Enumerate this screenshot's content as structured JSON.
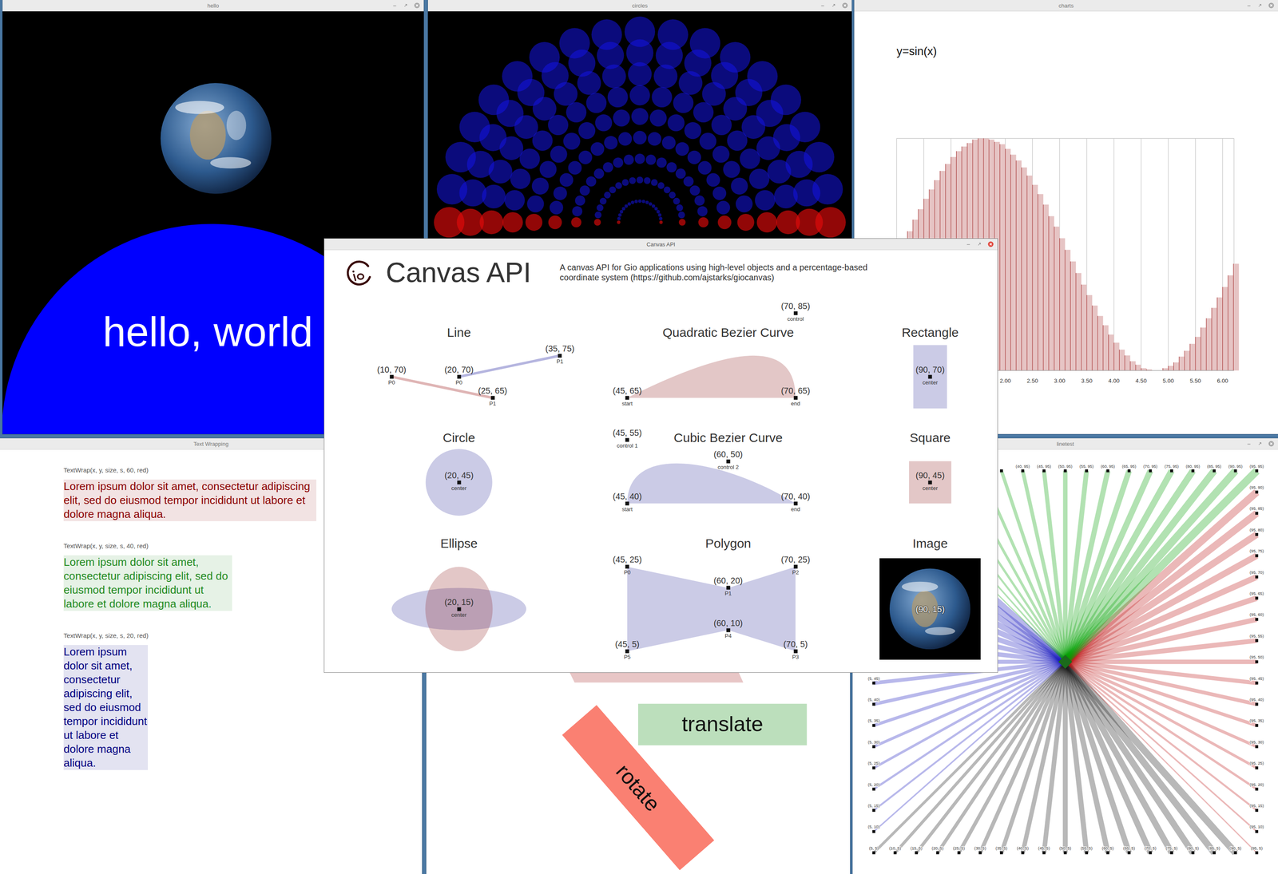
{
  "windows": [
    {
      "kind": "hello",
      "title": "hello",
      "focused": false,
      "text": "hello, world"
    },
    {
      "kind": "circles",
      "title": "circles",
      "focused": false
    },
    {
      "kind": "charts",
      "title": "charts",
      "focused": false,
      "chart": {
        "title": "y=sin(x)",
        "x_ticks": [
          "2.00",
          "2.50",
          "3.00",
          "3.50",
          "4.00",
          "4.50",
          "5.00",
          "5.50",
          "6.00"
        ],
        "series": [
          {
            "values": [
              0.0,
              0.1,
              0.2,
              0.3,
              0.39,
              0.48,
              0.56,
              0.64,
              0.72,
              0.78,
              0.84,
              0.89,
              0.93,
              0.96,
              0.99,
              1.0,
              1.0,
              0.99,
              0.97,
              0.95,
              0.91,
              0.86,
              0.81,
              0.75,
              0.68,
              0.6,
              0.52,
              0.43,
              0.33,
              0.24,
              0.14,
              0.04,
              -0.06,
              -0.16,
              -0.26,
              -0.35,
              -0.44,
              -0.53,
              -0.61,
              -0.69,
              -0.76,
              -0.82,
              -0.87,
              -0.92,
              -0.95,
              -0.98,
              -0.99,
              -1.0,
              -1.0,
              -0.98,
              -0.96,
              -0.93,
              -0.88,
              -0.83,
              -0.77,
              -0.71,
              -0.63,
              -0.55,
              -0.46,
              -0.37,
              -0.28,
              -0.18,
              -0.08
            ]
          }
        ]
      }
    },
    {
      "kind": "text_wrapping",
      "title": "Text Wrapping",
      "focused": false,
      "blocks": [
        {
          "caption": "TextWrap(x, y, size, s, 60, red)",
          "text": "Lorem ipsum dolor sit amet, consectetur adipiscing elit, sed do eiusmod tempor incididunt ut labore et dolore magna aliqua.",
          "color": "#8b0000"
        },
        {
          "caption": "TextWrap(x, y, size, s, 40, red)",
          "text": "Lorem ipsum dolor sit amet, consectetur adipiscing elit, sed do eiusmod tempor incididunt ut labore et dolore magna aliqua.",
          "color": "#1f8a1f"
        },
        {
          "caption": "TextWrap(x, y, size, s, 20, red)",
          "text": "Lorem ipsum dolor sit amet, consectetur adipiscing elit, sed do eiusmod tempor incididunt ut labore et dolore magna aliqua.",
          "color": "#000080"
        }
      ]
    },
    {
      "kind": "transforms",
      "focused": false,
      "shapes": [
        {
          "kind": "translate",
          "text": "translate"
        },
        {
          "kind": "rotate",
          "text": "rotate"
        }
      ]
    },
    {
      "kind": "linetest",
      "title": "linetest",
      "focused": false,
      "labels": [
        "(5, 5)",
        "(10, 5)",
        "(15, 5)",
        "(20, 5)",
        "(25, 5)",
        "(30, 5)",
        "(35, 5)",
        "(40, 5)",
        "(45, 5)",
        "(50, 5)",
        "(55, 5)",
        "(60, 5)",
        "(65, 5)",
        "(70, 5)",
        "(75, 5)",
        "(80, 5)",
        "(85, 5)",
        "(90, 5)",
        "(95, 5)",
        "(5, 10)",
        "(5, 15)",
        "(5, 20)",
        "(5, 25)",
        "(5, 30)",
        "(5, 35)",
        "(5, 40)",
        "(5, 45)",
        "(95, 10)",
        "(95, 15)",
        "(95, 20)",
        "(95, 25)",
        "(95, 30)",
        "(95, 35)",
        "(95, 40)",
        "(95, 45)",
        "(95, 50)",
        "(95, 55)",
        "(95, 60)",
        "(95, 65)",
        "(95, 70)",
        "(95, 75)",
        "(95, 80)",
        "(95, 85)",
        "(95, 90)",
        "(40, 95)",
        "(45, 95)",
        "(50, 95)",
        "(55, 95)",
        "(60, 95)",
        "(65, 95)",
        "(70, 95)",
        "(75, 95)",
        "(80, 95)",
        "(85, 95)",
        "(90, 95)",
        "(95, 95)"
      ]
    },
    {
      "kind": "canvas_api",
      "title": "Canvas API",
      "focused": true,
      "heading": "Canvas API",
      "description": "A canvas API for Gio applications using high-level objects and a percentage-based coordinate system (https://github.com/ajstarks/giocanvas)",
      "sections": [
        {
          "title": "Line",
          "kind": "line",
          "points": [
            {
              "label": "(10, 70)",
              "sub": "P0"
            },
            {
              "label": "(25, 65)",
              "sub": "P1"
            },
            {
              "label": "(20, 70)",
              "sub": "P0"
            },
            {
              "label": "(35, 75)",
              "sub": "P1"
            }
          ]
        },
        {
          "title": "Quadratic Bezier Curve",
          "kind": "quadratic",
          "points": [
            {
              "label": "(45, 65)",
              "sub": "start"
            },
            {
              "label": "(70, 85)",
              "sub": "control"
            },
            {
              "label": "(70, 65)",
              "sub": "end"
            }
          ]
        },
        {
          "title": "Rectangle",
          "kind": "rectangle",
          "points": [
            {
              "label": "(90, 70)",
              "sub": "center"
            }
          ]
        },
        {
          "title": "Circle",
          "kind": "circle",
          "points": [
            {
              "label": "(20, 45)",
              "sub": "center"
            }
          ]
        },
        {
          "title": "Cubic Bezier Curve",
          "kind": "cubic",
          "points": [
            {
              "label": "(45, 40)",
              "sub": "start"
            },
            {
              "label": "(45, 55)",
              "sub": "control 1"
            },
            {
              "label": "(60, 50)",
              "sub": "control 2"
            },
            {
              "label": "(70, 40)",
              "sub": "end"
            }
          ]
        },
        {
          "title": "Square",
          "kind": "square",
          "points": [
            {
              "label": "(90, 45)",
              "sub": "center"
            }
          ]
        },
        {
          "title": "Ellipse",
          "kind": "ellipse",
          "points": [
            {
              "label": "(20, 15)",
              "sub": "center"
            }
          ]
        },
        {
          "title": "Polygon",
          "kind": "polygon",
          "points": [
            {
              "label": "(45, 25)",
              "sub": "P0"
            },
            {
              "label": "(60, 20)",
              "sub": "P1"
            },
            {
              "label": "(70, 25)",
              "sub": "P2"
            },
            {
              "label": "(70, 5)",
              "sub": "P3"
            },
            {
              "label": "(60, 10)",
              "sub": "P4"
            },
            {
              "label": "(45, 5)",
              "sub": "P5"
            }
          ]
        },
        {
          "title": "Image",
          "kind": "image",
          "points": [
            {
              "label": "(90, 15)"
            }
          ]
        }
      ]
    }
  ]
}
